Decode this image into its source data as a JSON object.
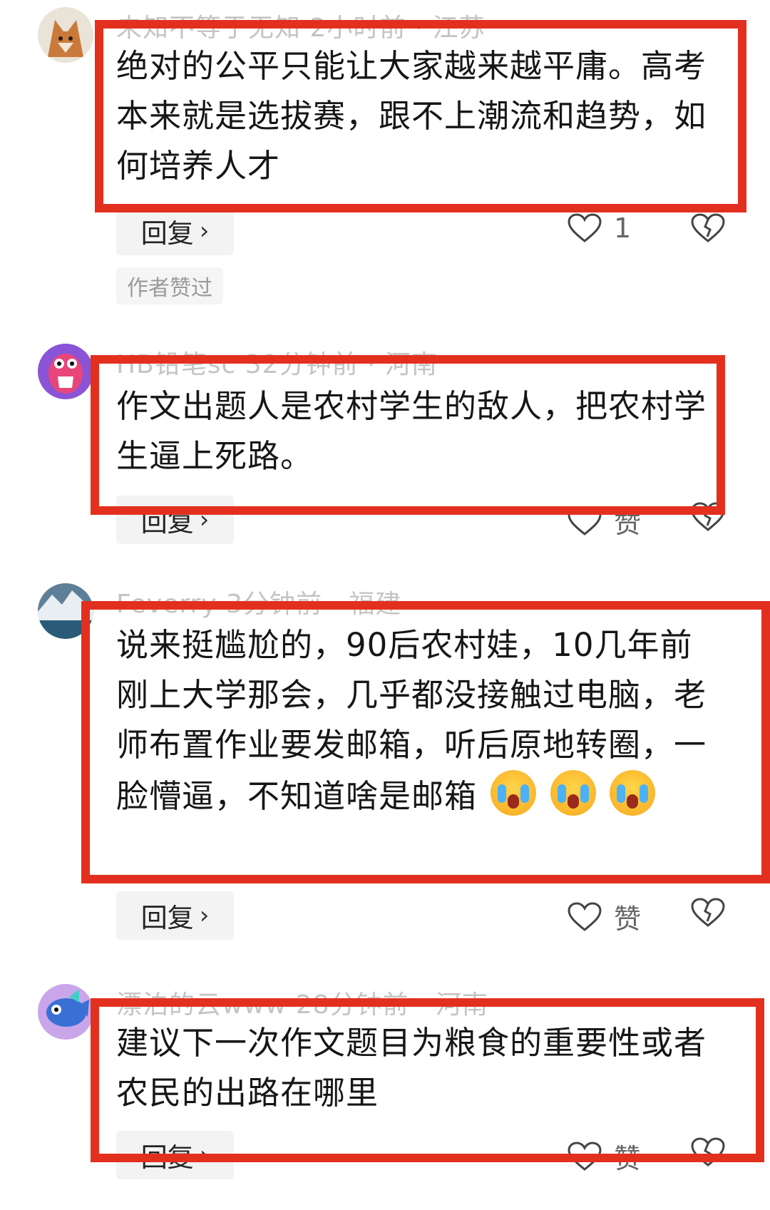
{
  "comments": [
    {
      "meta": "未知不等于无知  2小时前 · 江苏",
      "text": "绝对的公平只能让大家越来越平庸。高考本来就是选拔赛，跟不上潮流和趋势，如何培养人才",
      "reply_label": "回复",
      "like_label": "1",
      "author_badge": "作者赞过"
    },
    {
      "meta": "HB铅笔sc  32分钟前 · 河南",
      "text": "作文出题人是农村学生的敌人，把农村学生逼上死路。",
      "reply_label": "回复",
      "like_label": "赞"
    },
    {
      "meta": "Feverry  3分钟前 · 福建",
      "text": "说来挺尴尬的，90后农村娃，10几年前刚上大学那会，几乎都没接触过电脑，老师布置作业要发邮箱，听后原地转圈，一脸懵逼，不知道啥是邮箱",
      "reply_label": "回复",
      "like_label": "赞"
    },
    {
      "meta": "漂泊的云www  28分钟前 · 河南",
      "text": "建议下一次作文题目为粮食的重要性或者农民的出路在哪里",
      "reply_label": "回复",
      "like_label": "赞"
    }
  ],
  "icons": {
    "like": "heart-outline-icon",
    "dislike": "broken-heart-icon",
    "emoji": "crying-face-emoji"
  },
  "colors": {
    "highlight": "#e3301e",
    "meta": "#c4c4c4"
  }
}
